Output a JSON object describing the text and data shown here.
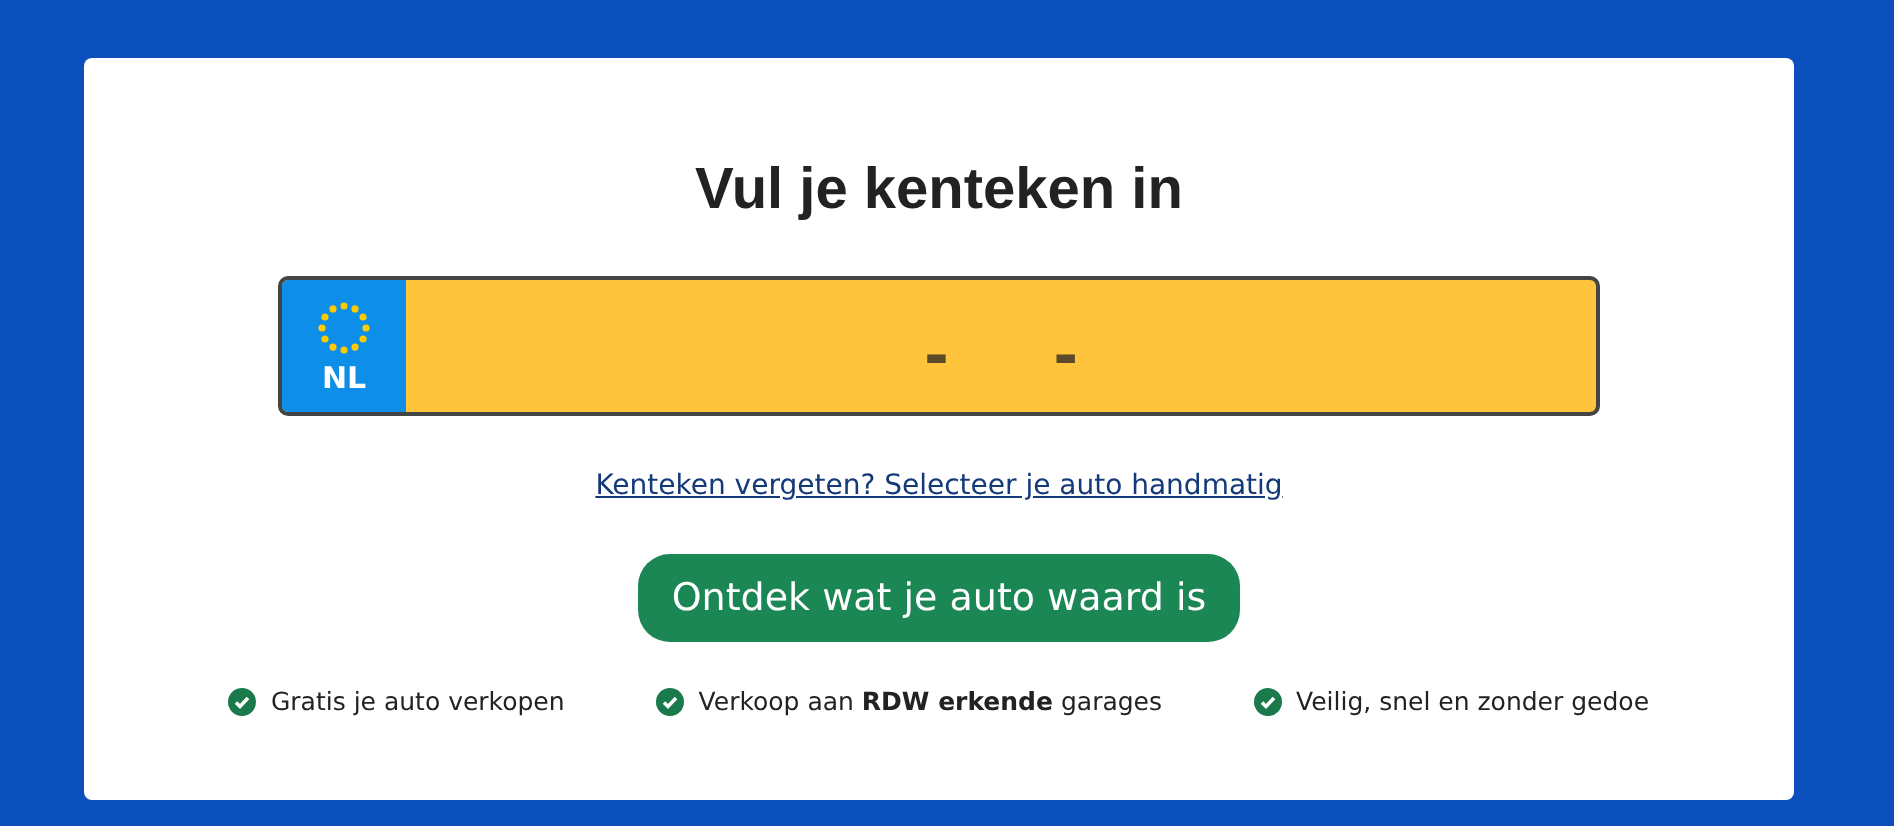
{
  "title": "Vul je kenteken in",
  "plate": {
    "country": "NL",
    "placeholder": "-     -"
  },
  "link": "Kenteken vergeten? Selecteer je auto handmatig",
  "button": "Ontdek wat je auto waard is",
  "features": [
    {
      "text": "Gratis je auto verkopen"
    },
    {
      "text": "Verkoop aan **RDW erkende** garages"
    },
    {
      "text": "Veilig, snel en zonder gedoe"
    }
  ]
}
